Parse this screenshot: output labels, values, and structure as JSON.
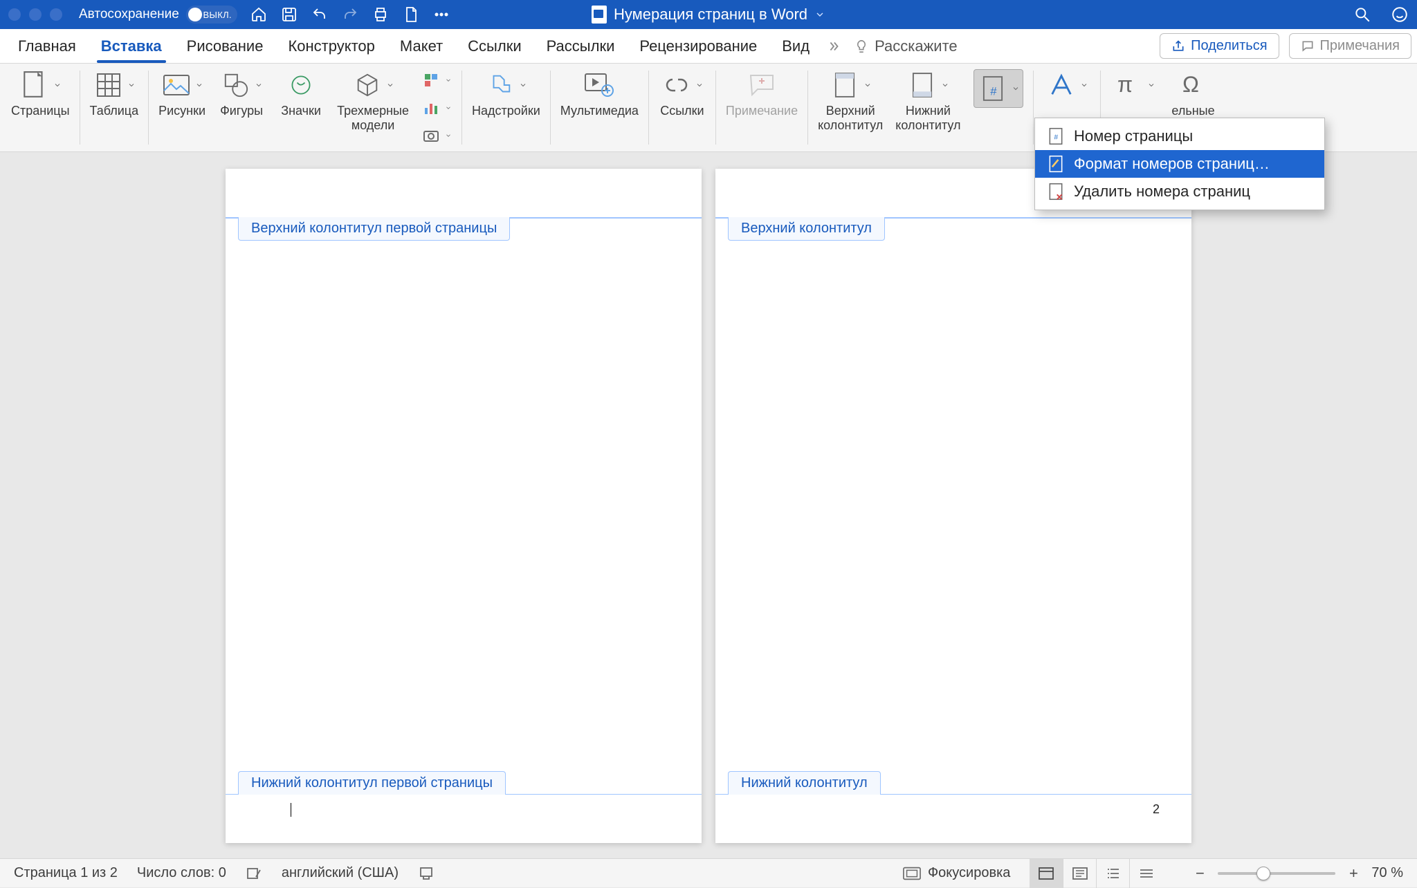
{
  "titlebar": {
    "autosave_label": "Автосохранение",
    "autosave_state": "ВЫКЛ.",
    "doc_title": "Нумерация страниц в Word"
  },
  "tabs": {
    "items": [
      "Главная",
      "Вставка",
      "Рисование",
      "Конструктор",
      "Макет",
      "Ссылки",
      "Рассылки",
      "Рецензирование",
      "Вид"
    ],
    "active_index": 1,
    "tell_me": "Расскажите",
    "share": "Поделиться",
    "comments": "Примечания"
  },
  "ribbon": {
    "pages": "Страницы",
    "table": "Таблица",
    "pictures": "Рисунки",
    "shapes": "Фигуры",
    "icons": "Значки",
    "models3d": "Трехмерные\nмодели",
    "addins": "Надстройки",
    "media": "Мультимедиа",
    "links": "Ссылки",
    "comment": "Примечание",
    "header": "Верхний\nколонтитул",
    "footer": "Нижний\nколонтитул",
    "symbols_partial": "ельные\nлы"
  },
  "popup": {
    "item1": "Номер страницы",
    "item2": "Формат номеров страниц…",
    "item3": "Удалить номера страниц"
  },
  "pages_view": {
    "p1_header": "Верхний колонтитул первой страницы",
    "p1_footer": "Нижний колонтитул первой страницы",
    "p1_cursor": "",
    "p2_header": "Верхний колонтитул",
    "p2_footer": "Нижний колонтитул",
    "p2_num": "2"
  },
  "status": {
    "page": "Страница 1 из 2",
    "words": "Число слов: 0",
    "lang": "английский (США)",
    "focus": "Фокусировка",
    "zoom": "70 %"
  }
}
